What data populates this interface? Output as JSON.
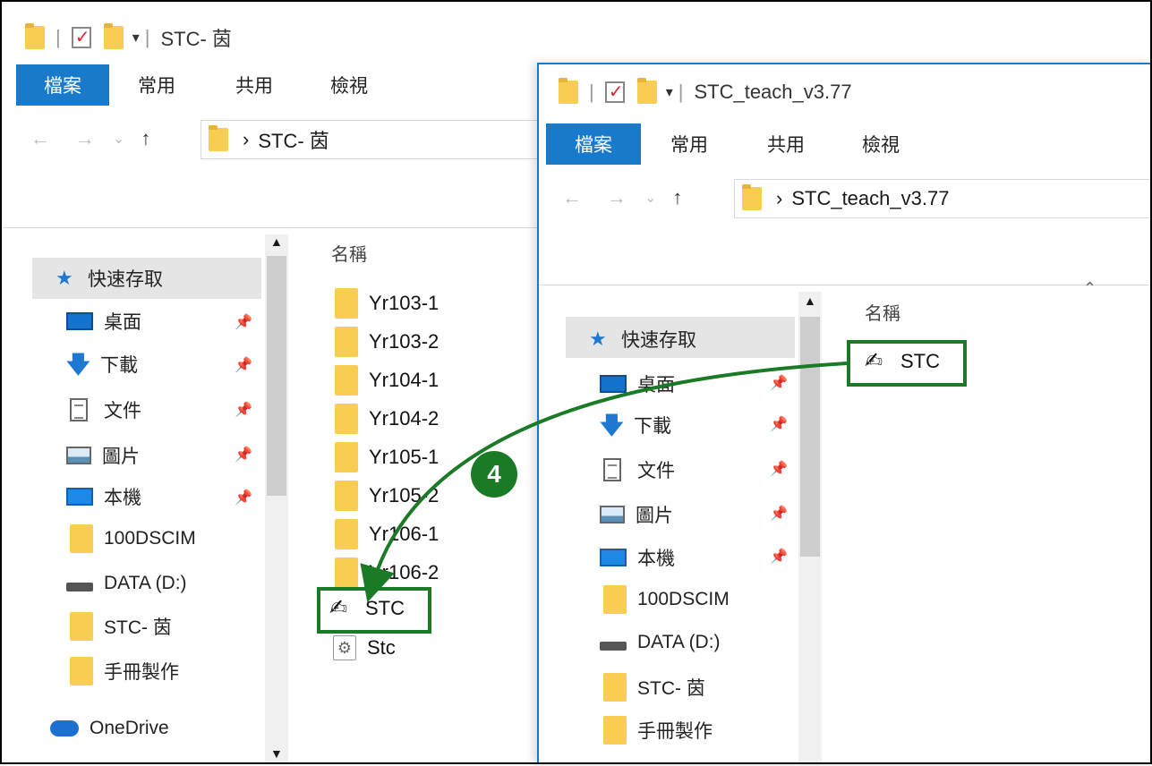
{
  "back_window": {
    "title": "STC- 茵",
    "tabs": [
      "檔案",
      "常用",
      "共用",
      "檢視"
    ],
    "path": "STC- 茵",
    "nav_glyphs": {
      "back": "←",
      "forward": "→",
      "recent": "⌄",
      "up": "↑",
      "crumb": "›"
    },
    "column_header": "名稱",
    "sidebar": {
      "quick_access": "快速存取",
      "items": [
        {
          "label": "桌面",
          "icon": "desktop-icon",
          "pinned": true
        },
        {
          "label": "下載",
          "icon": "download-icon",
          "pinned": true
        },
        {
          "label": "文件",
          "icon": "document-icon",
          "pinned": true
        },
        {
          "label": "圖片",
          "icon": "picture-icon",
          "pinned": true
        },
        {
          "label": "本機",
          "icon": "pc-icon",
          "pinned": true
        },
        {
          "label": "100DSCIM",
          "icon": "folder-icon",
          "pinned": false
        },
        {
          "label": "DATA (D:)",
          "icon": "drive-icon",
          "pinned": false
        },
        {
          "label": "STC- 茵",
          "icon": "folder-icon",
          "pinned": false
        },
        {
          "label": "手冊製作",
          "icon": "folder-icon",
          "pinned": false
        }
      ],
      "onedrive": "OneDrive"
    },
    "files": [
      {
        "name": "Yr103-1",
        "icon": "folder-icon"
      },
      {
        "name": "Yr103-2",
        "icon": "folder-icon"
      },
      {
        "name": "Yr104-1",
        "icon": "folder-icon"
      },
      {
        "name": "Yr104-2",
        "icon": "folder-icon"
      },
      {
        "name": "Yr105-1",
        "icon": "folder-icon"
      },
      {
        "name": "Yr105-2",
        "icon": "folder-icon"
      },
      {
        "name": "Yr106-1",
        "icon": "folder-icon"
      },
      {
        "name": "Yr106-2",
        "icon": "folder-icon"
      },
      {
        "name": "STC",
        "icon": "stc-app-icon"
      },
      {
        "name": "Stc",
        "icon": "config-file-icon"
      }
    ]
  },
  "front_window": {
    "title": "STC_teach_v3.77",
    "tabs": [
      "檔案",
      "常用",
      "共用",
      "檢視"
    ],
    "path": "STC_teach_v3.77",
    "column_header": "名稱",
    "sidebar": {
      "quick_access": "快速存取",
      "items": [
        {
          "label": "桌面",
          "icon": "desktop-icon",
          "pinned": true
        },
        {
          "label": "下載",
          "icon": "download-icon",
          "pinned": true
        },
        {
          "label": "文件",
          "icon": "document-icon",
          "pinned": true
        },
        {
          "label": "圖片",
          "icon": "picture-icon",
          "pinned": true
        },
        {
          "label": "本機",
          "icon": "pc-icon",
          "pinned": true
        },
        {
          "label": "100DSCIM",
          "icon": "folder-icon",
          "pinned": false
        },
        {
          "label": "DATA (D:)",
          "icon": "drive-icon",
          "pinned": false
        },
        {
          "label": "STC- 茵",
          "icon": "folder-icon",
          "pinned": false
        },
        {
          "label": "手冊製作",
          "icon": "folder-icon",
          "pinned": false
        }
      ]
    },
    "files": [
      {
        "name": "STC",
        "icon": "stc-app-icon"
      }
    ]
  },
  "annotation": {
    "step": "4",
    "color": "#1a7a26"
  },
  "colors": {
    "file_tab": "#1979ca",
    "window_border": "#1979ca",
    "folder": "#f9cc52"
  }
}
